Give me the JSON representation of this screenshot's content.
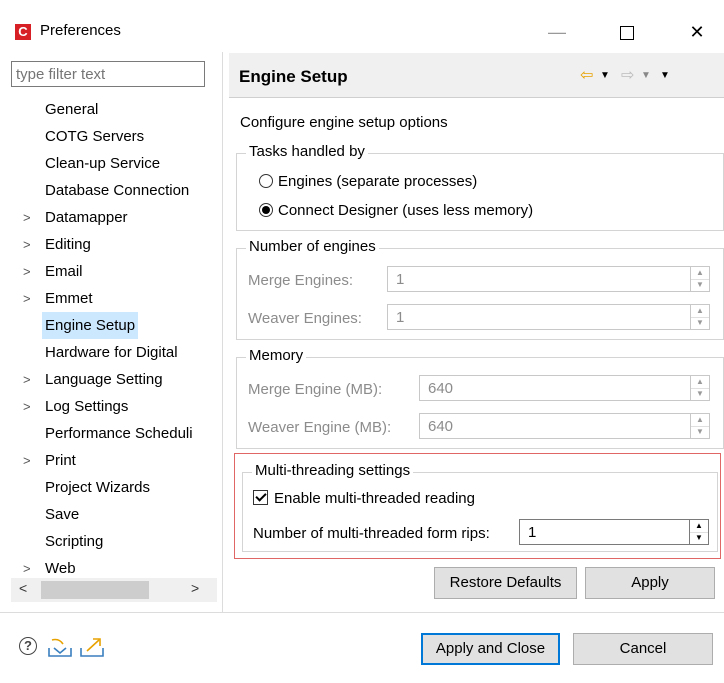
{
  "window": {
    "title": "Preferences",
    "app_icon_letter": "C",
    "minimize": "—",
    "close": "✕"
  },
  "filter": {
    "placeholder": "type filter text"
  },
  "tree": [
    {
      "label": "General",
      "expandable": false
    },
    {
      "label": "COTG Servers",
      "expandable": false
    },
    {
      "label": "Clean-up Service",
      "expandable": false
    },
    {
      "label": "Database Connection",
      "expandable": false
    },
    {
      "label": "Datamapper",
      "expandable": true
    },
    {
      "label": "Editing",
      "expandable": true
    },
    {
      "label": "Email",
      "expandable": true
    },
    {
      "label": "Emmet",
      "expandable": true
    },
    {
      "label": "Engine Setup",
      "expandable": false,
      "selected": true
    },
    {
      "label": "Hardware for Digital",
      "expandable": false
    },
    {
      "label": "Language Setting",
      "expandable": true
    },
    {
      "label": "Log Settings",
      "expandable": true
    },
    {
      "label": "Performance Scheduli",
      "expandable": false
    },
    {
      "label": "Print",
      "expandable": true
    },
    {
      "label": "Project Wizards",
      "expandable": false
    },
    {
      "label": "Save",
      "expandable": false
    },
    {
      "label": "Scripting",
      "expandable": false
    },
    {
      "label": "Web",
      "expandable": true
    }
  ],
  "page": {
    "title": "Engine Setup",
    "description": "Configure engine setup options",
    "tasks": {
      "legend": "Tasks handled by",
      "option_engines": "Engines (separate processes)",
      "option_designer": "Connect Designer (uses less memory)",
      "selected": "designer"
    },
    "engines": {
      "legend": "Number of engines",
      "merge_label": "Merge Engines:",
      "merge_value": "1",
      "weaver_label": "Weaver Engines:",
      "weaver_value": "1"
    },
    "memory": {
      "legend": "Memory",
      "merge_label": "Merge Engine (MB):",
      "merge_value": "640",
      "weaver_label": "Weaver Engine (MB):",
      "weaver_value": "640"
    },
    "threading": {
      "legend": "Multi-threading settings",
      "enable_label": "Enable multi-threaded reading",
      "enable_checked": true,
      "rips_label": "Number of multi-threaded form rips:",
      "rips_value": "1"
    },
    "restore_defaults": "Restore Defaults",
    "apply": "Apply"
  },
  "footer": {
    "apply_close": "Apply and Close",
    "cancel": "Cancel"
  },
  "colors": {
    "selection": "#cce8ff",
    "highlight_box": "#e06666",
    "default_button_border": "#0078d7",
    "back_arrow": "#e8a200"
  }
}
